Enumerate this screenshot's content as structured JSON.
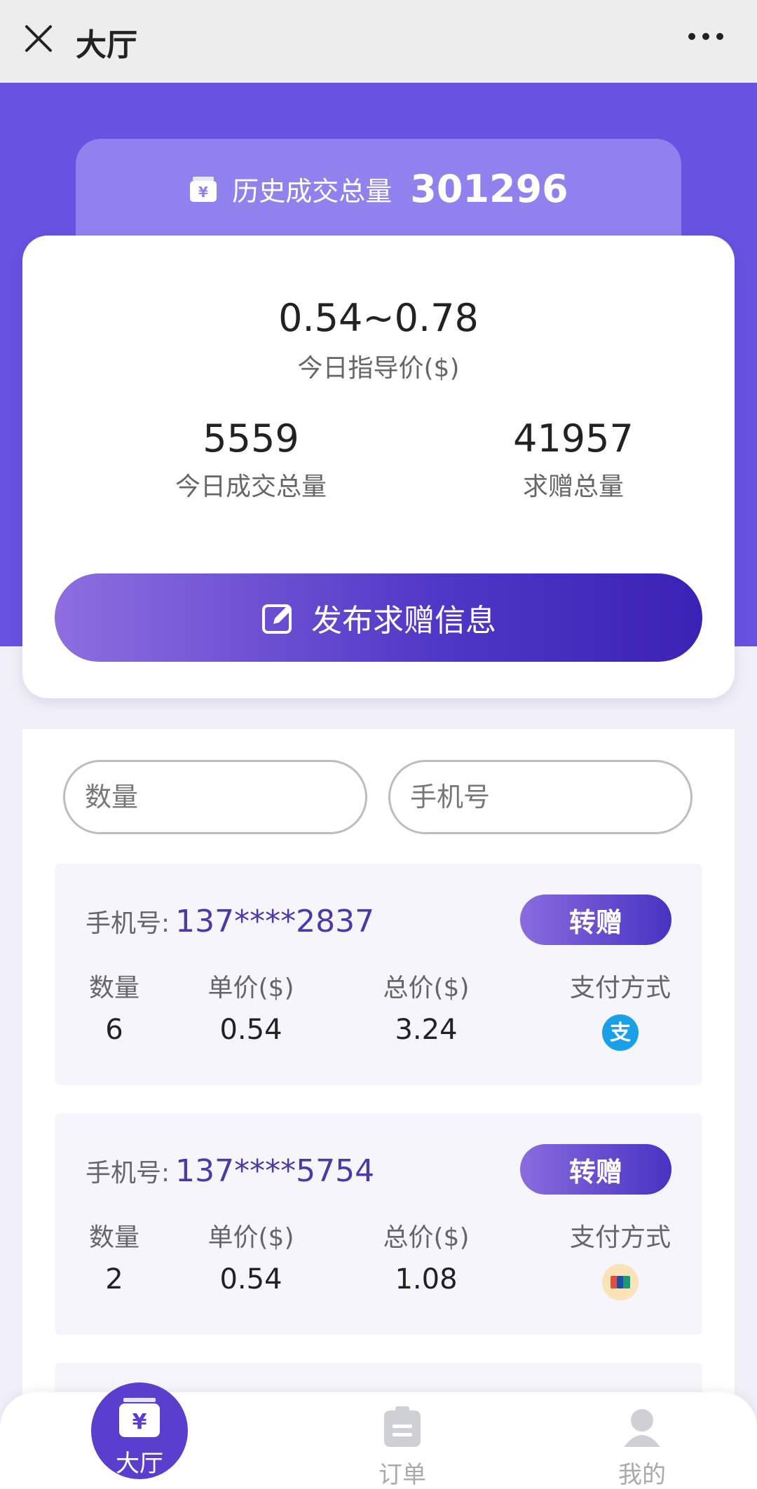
{
  "topbar": {
    "title": "大厅"
  },
  "history": {
    "label": "历史成交总量",
    "value": "301296"
  },
  "guide": {
    "value": "0.54~0.78",
    "label": "今日指导价($)"
  },
  "stats": [
    {
      "value": "5559",
      "label": "今日成交总量"
    },
    {
      "value": "41957",
      "label": "求赠总量"
    }
  ],
  "publish": {
    "label": "发布求赠信息"
  },
  "search": {
    "quantity_placeholder": "数量",
    "phone_placeholder": "手机号"
  },
  "list": {
    "phone_label": "手机号:",
    "gift_label": "转赠",
    "columns": [
      "数量",
      "单价($)",
      "总价($)",
      "支付方式"
    ],
    "items": [
      {
        "phone": "137****2837",
        "quantity": "6",
        "unit_price": "0.54",
        "total_price": "3.24",
        "payment": "alipay-icon"
      },
      {
        "phone": "137****5754",
        "quantity": "2",
        "unit_price": "0.54",
        "total_price": "1.08",
        "payment": "unionpay-icon"
      }
    ]
  },
  "tabs": [
    {
      "label": "大厅",
      "icon": "hall-icon"
    },
    {
      "label": "订单",
      "icon": "order-icon"
    },
    {
      "label": "我的",
      "icon": "profile-icon"
    }
  ],
  "colors": {
    "primary": "#6752e2",
    "accent": "#4a3aa8",
    "alipay": "#1aa0e8",
    "unionpay": "#e94b3c"
  }
}
